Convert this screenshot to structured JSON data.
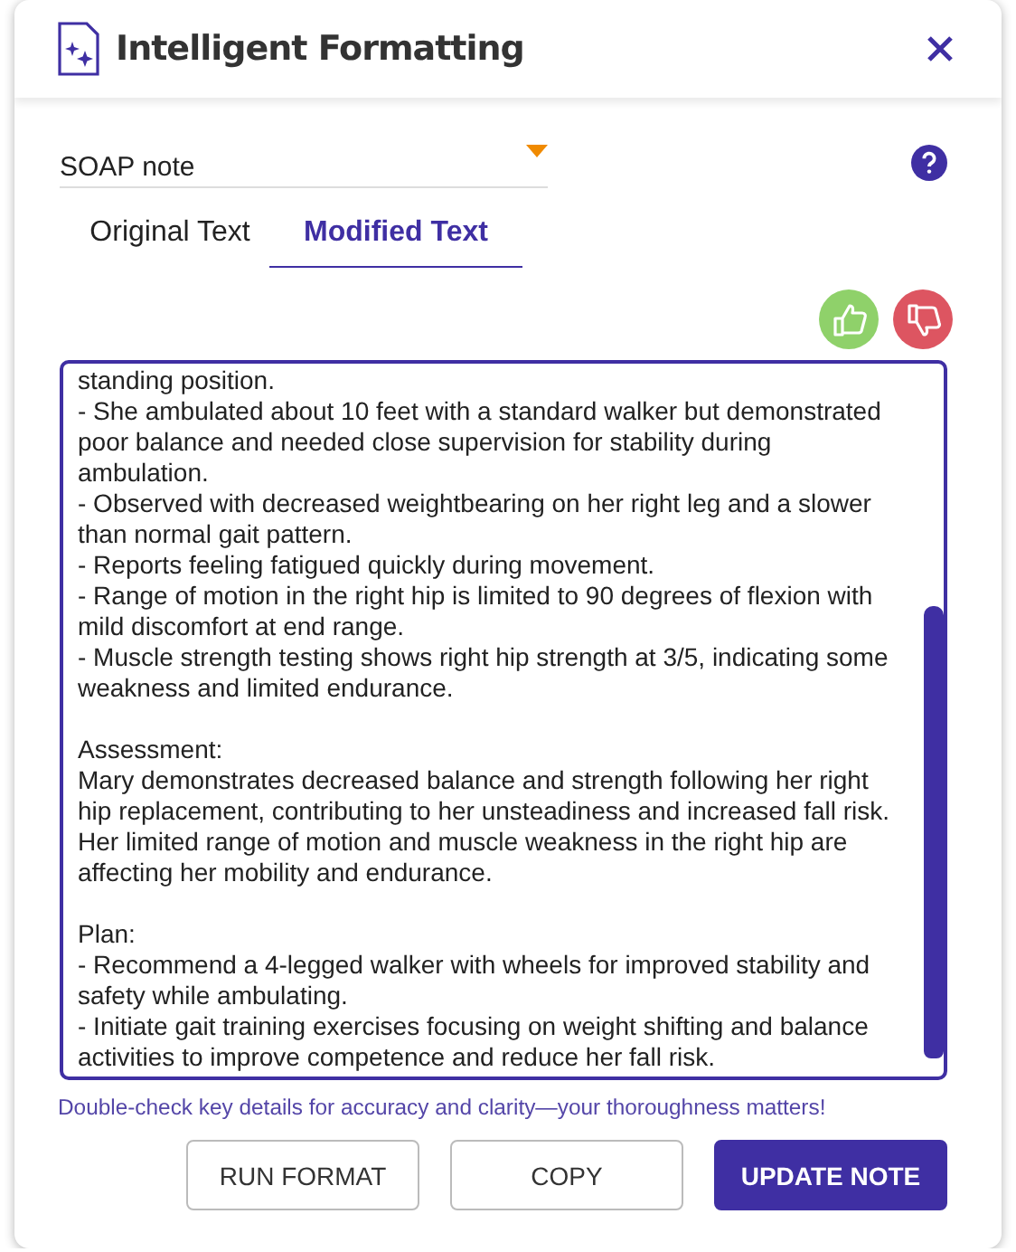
{
  "window": {
    "title": "Intelligent Formatting"
  },
  "template_select": {
    "value": "SOAP note"
  },
  "tabs": [
    {
      "label": "Original Text",
      "selected": false
    },
    {
      "label": "Modified Text",
      "selected": true
    }
  ],
  "editor": {
    "sections": [
      {
        "lines": [
          "standing position.",
          "- She ambulated about 10 feet with a standard walker but demonstrated poor balance and needed close supervision for stability during ambulation.",
          "- Observed with decreased weightbearing on her right leg and a slower than normal gait pattern.",
          "- Reports feeling fatigued quickly during movement.",
          "- Range of motion in the right hip is limited to 90 degrees of flexion with mild discomfort at end range.",
          "- Muscle strength testing shows right hip strength at 3/5, indicating some weakness and limited endurance."
        ]
      },
      {
        "lines": [
          "Assessment:",
          "Mary demonstrates decreased balance and strength following her right hip replacement, contributing to her unsteadiness and increased fall risk. Her limited range of motion and muscle weakness in the right hip are affecting her mobility and endurance."
        ]
      },
      {
        "lines": [
          "Plan:",
          "- Recommend a 4-legged walker with wheels for improved stability and safety while ambulating.",
          "- Initiate gait training exercises focusing on weight shifting and balance activities to improve competence and reduce her fall risk."
        ]
      }
    ]
  },
  "hint": "Double-check key details for accuracy and clarity—your thoroughness matters!",
  "buttons": [
    {
      "label": "RUN FORMAT",
      "kind": "outline"
    },
    {
      "label": "COPY",
      "kind": "outline"
    },
    {
      "label": "UPDATE NOTE",
      "kind": "primary"
    }
  ]
}
